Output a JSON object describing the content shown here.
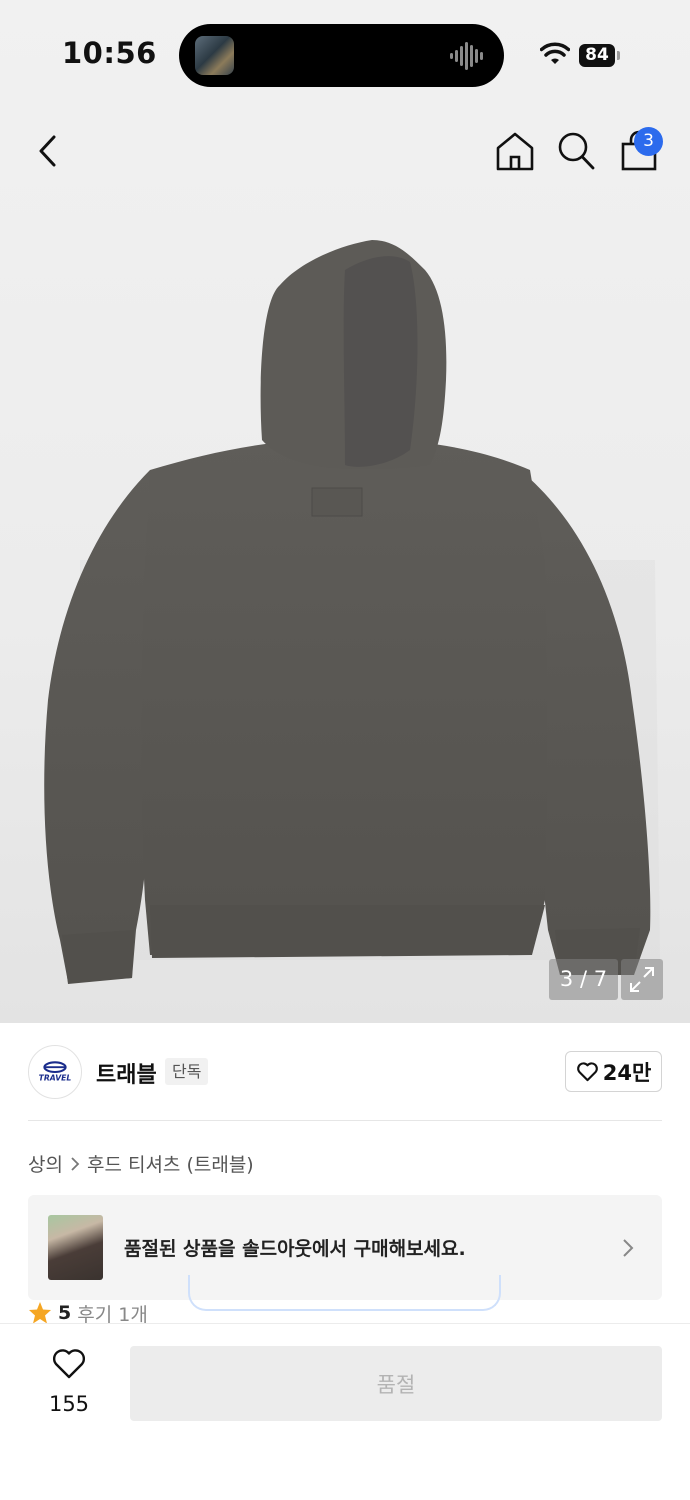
{
  "status": {
    "time": "10:56",
    "battery": "84"
  },
  "nav": {
    "back_icon": "chevron-left-icon",
    "home_icon": "home-icon",
    "search_icon": "search-icon",
    "cart_icon": "shopping-bag-icon",
    "cart_badge": "3"
  },
  "gallery": {
    "counter": "3 / 7",
    "expand_icon": "expand-icon"
  },
  "brand": {
    "name": "트래블",
    "logo_text": "TRAVEL",
    "tag": "단독",
    "likes": "24만"
  },
  "breadcrumb": {
    "category": "상의",
    "subcategory": "후드 티셔츠 (트래블)"
  },
  "banner": {
    "text": "품절된 상품을 솔드아웃에서 구매해보세요."
  },
  "rating": {
    "score": "5",
    "reviews": "후기 1개"
  },
  "bottom": {
    "wish_count": "155",
    "buy_label": "품절"
  },
  "colors": {
    "accent": "#2c6bed",
    "star": "#f5a623",
    "hoodie": "#5b5955"
  }
}
